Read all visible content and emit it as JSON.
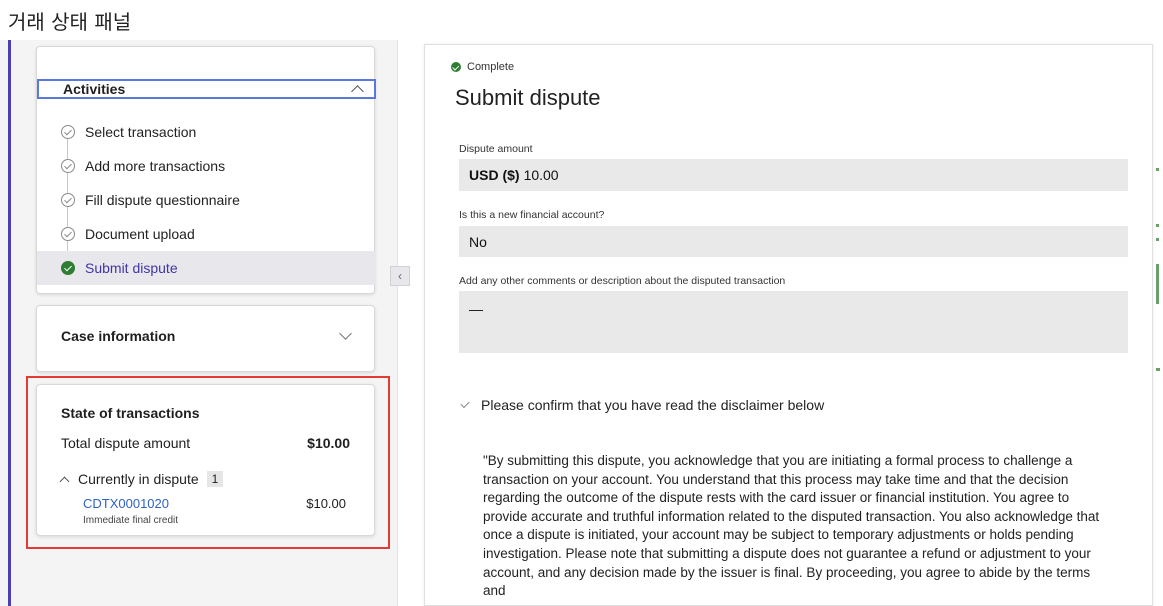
{
  "page": {
    "caption": "거래 상태 패널"
  },
  "activities": {
    "title": "Activities",
    "steps": [
      {
        "label": "Select transaction",
        "status": "done"
      },
      {
        "label": "Add more transactions",
        "status": "done"
      },
      {
        "label": "Fill dispute questionnaire",
        "status": "done"
      },
      {
        "label": "Document upload",
        "status": "done"
      },
      {
        "label": "Submit dispute",
        "status": "complete-active"
      }
    ]
  },
  "case_info": {
    "title": "Case information"
  },
  "state_of_transactions": {
    "title": "State of transactions",
    "total_label": "Total dispute amount",
    "total_amount": "$10.00",
    "currently_in_dispute_label": "Currently in dispute",
    "currently_in_dispute_count": "1",
    "transaction": {
      "id": "CDTX0001020",
      "amount": "$10.00",
      "subtitle": "Immediate final credit"
    }
  },
  "sidebar_toggle": {
    "glyph": "‹"
  },
  "main": {
    "status": "Complete",
    "title": "Submit dispute",
    "dispute_amount": {
      "label": "Dispute amount",
      "currency": "USD ($)",
      "value": "10.00"
    },
    "new_account": {
      "label": "Is this a new financial account?",
      "value": "No"
    },
    "comments": {
      "label": "Add any other comments or description about the disputed transaction",
      "value": "—"
    },
    "confirm_label": "Please confirm that you have read the disclaimer below",
    "disclaimer": "\"By submitting this dispute, you acknowledge that you are initiating a formal process to challenge a transaction on your account. You understand that this process may take time and that the decision regarding the outcome of the dispute rests with the card issuer or financial institution. You agree to provide accurate and truthful information related to the disputed transaction. You also acknowledge that once a dispute is initiated, your account may be subject to temporary adjustments or holds pending investigation. Please note that submitting a dispute does not guarantee a refund or adjustment to your account, and any decision made by the issuer is final. By proceeding, you agree to abide by the terms and"
  },
  "colors": {
    "accent": "#4b3fb3",
    "link": "#2f63c4",
    "success": "#2e7d32",
    "highlight": "#e53935",
    "focus": "#5b78dc"
  }
}
